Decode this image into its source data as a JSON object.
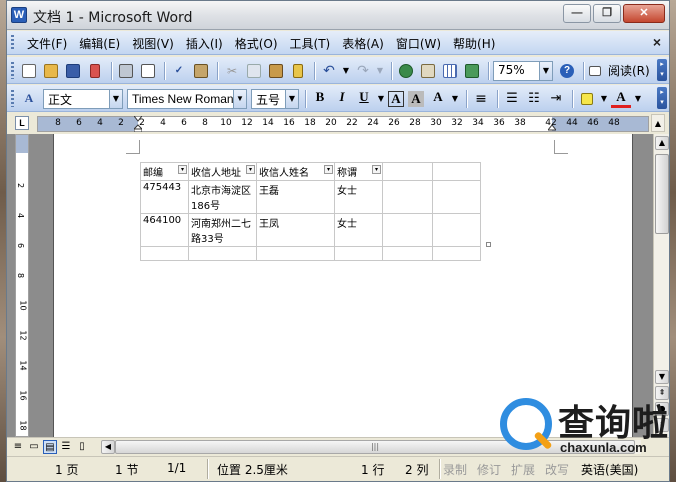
{
  "window": {
    "title": "文档 1 - Microsoft Word"
  },
  "menu": {
    "items": [
      "文件(F)",
      "编辑(E)",
      "视图(V)",
      "插入(I)",
      "格式(O)",
      "工具(T)",
      "表格(A)",
      "窗口(W)",
      "帮助(H)"
    ],
    "close_glyph": "×"
  },
  "toolbar_standard": {
    "zoom": "75%",
    "read_label": "阅读(R)"
  },
  "toolbar_format": {
    "style": "正文",
    "font": "Times New Roman",
    "size": "五号"
  },
  "ruler": {
    "ticks": [
      "8",
      "6",
      "4",
      "2",
      "2",
      "4",
      "6",
      "8",
      "10",
      "12",
      "14",
      "16",
      "18",
      "20",
      "22",
      "24",
      "26",
      "28",
      "30",
      "32",
      "34",
      "36",
      "38",
      "42",
      "44",
      "46",
      "48"
    ]
  },
  "vruler": {
    "ticks": [
      "2",
      "4",
      "6",
      "8",
      "10",
      "12",
      "14",
      "16",
      "18"
    ]
  },
  "table": {
    "headers": [
      "邮编",
      "收信人地址",
      "收信人姓名",
      "称谓",
      "",
      ""
    ],
    "rows": [
      [
        "475443",
        "北京市海淀区186号",
        "王磊",
        "女士",
        "",
        ""
      ],
      [
        "464100",
        "河南郑州二七路33号",
        "王凤",
        "女士",
        "",
        ""
      ],
      [
        "",
        "",
        "",
        "",
        "",
        ""
      ]
    ]
  },
  "status": {
    "page": "1 页",
    "section": "1 节",
    "pages": "1/1",
    "position": "位置 2.5厘米",
    "line": "1 行",
    "column": "2 列",
    "rec": "录制",
    "trk": "修订",
    "ext": "扩展",
    "ovr": "改写",
    "language": "英语(美国)"
  },
  "watermark": {
    "brand": "查询啦",
    "url": "chaxunla.com"
  },
  "colors": {
    "menubar": "#c3d6f1",
    "toolbar": "#bcd0ee",
    "page_bg": "#ffffff",
    "doc_gray": "#8c8c8c",
    "accent": "#2f8de0"
  }
}
